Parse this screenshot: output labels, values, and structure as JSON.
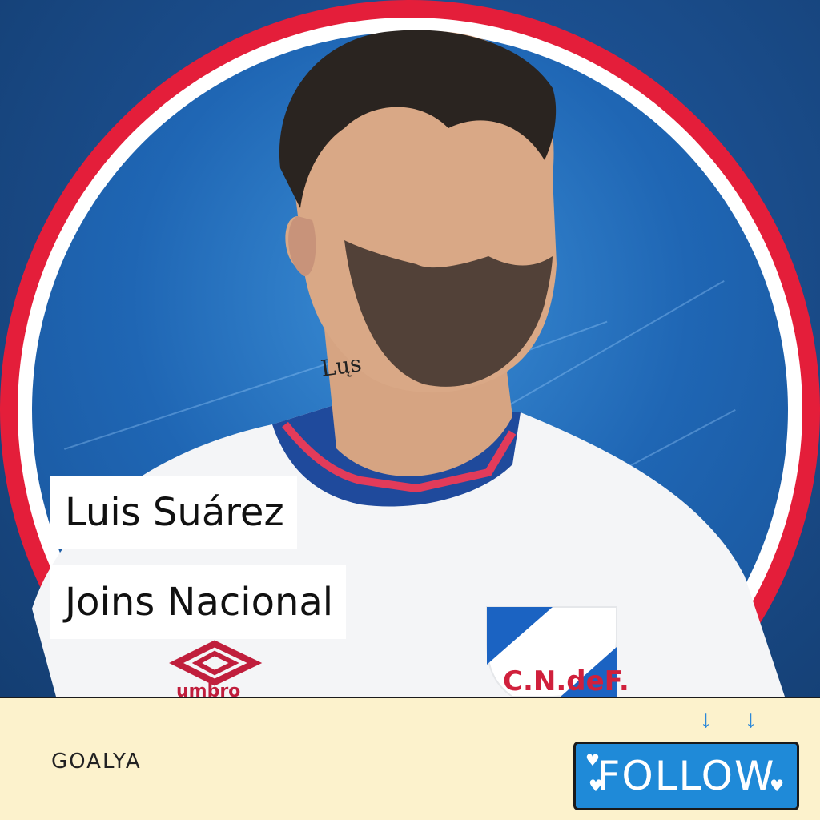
{
  "caption": {
    "line1": "Luis Suárez",
    "line2": "Joins Nacional"
  },
  "footer": {
    "brand": "GOALYA",
    "follow_label": "FOLLOW"
  },
  "jersey": {
    "brand_text": "umbro",
    "crest_text": "C.N.deF."
  },
  "colors": {
    "background_blue": "#1b4f8f",
    "ring_red": "#e41e3a",
    "ring_white": "#ffffff",
    "footer_bg": "#fcf2cc",
    "follow_bg": "#1f8ad8"
  },
  "icons": [
    "arrow-down-icon",
    "heart-icon",
    "umbro-logo-icon",
    "crest-icon"
  ]
}
